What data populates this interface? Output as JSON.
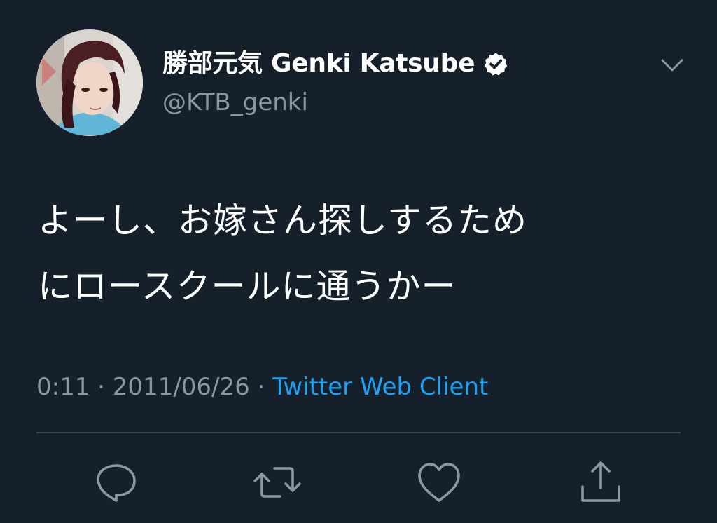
{
  "user": {
    "display_name": "勝部元気 Genki Katsube",
    "handle": "@KTB_genki",
    "verified": true
  },
  "tweet": {
    "text_lines": [
      "よーし、お嫁さん探しするため",
      "にロースクールに通うかー"
    ],
    "time": "0:11",
    "separator": "·",
    "date": "2011/06/26",
    "source": "Twitter Web Client"
  },
  "actions": {
    "reply_icon": "reply-icon",
    "retweet_icon": "retweet-icon",
    "like_icon": "heart-icon",
    "share_icon": "share-icon"
  },
  "colors": {
    "background": "#15202b",
    "text": "#ffffff",
    "secondary": "#8899a6",
    "link": "#1da1f2",
    "divider": "#38444d"
  }
}
